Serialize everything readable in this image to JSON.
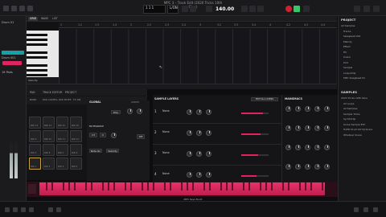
{
  "app_title": "MPC 3 – Track Edit (2020 Tricks 10th Slice)",
  "transport": {
    "bar_display": "1 1 1",
    "tempo": "140.00",
    "mode": "L/ON"
  },
  "left": {
    "track_label": "Drum 01",
    "program_label": "Drum 001",
    "pads_label": "16 Pads"
  },
  "seq_tabs": [
    "GRID",
    "WAVE",
    "LIST"
  ],
  "ruler": [
    "1",
    "1.2",
    "1.3",
    "1.4",
    "2",
    "2.2",
    "2.3",
    "2.4",
    "3",
    "3.2",
    "3.3",
    "3.4",
    "4",
    "4.2",
    "4.3",
    "4.4"
  ],
  "piano_label": "Velocity",
  "panel_tabs": [
    "PAD",
    "TRACK EDITOR",
    "PROJECT"
  ],
  "banks": [
    "BANK",
    "PAD CONFIG",
    "PAD MUTE",
    "FX ON",
    "STEP"
  ],
  "pads": [
    "PAD 13",
    "PAD 14",
    "PAD 15",
    "PAD 16",
    "PAD 9",
    "PAD 10",
    "PAD 11",
    "PAD 12",
    "PAD 5",
    "PAD 6",
    "PAD 7",
    "PAD 8",
    "PAD 1",
    "PAD 2",
    "PAD 3",
    "PAD 4"
  ],
  "global": {
    "header": "GLOBAL",
    "link": "LINKED",
    "poly_label": "Poly",
    "mute_group": "MUTEGROUP",
    "semi": "C3",
    "fine": "0",
    "sense": "Off",
    "sample_play": "Note On",
    "velocity": "Velocity"
  },
  "layers": {
    "header": "SAMPLE LAYERS",
    "edit_button": "EDIT ALL LAYERS",
    "rows": [
      {
        "num": "1",
        "name": "None",
        "vel": 100
      },
      {
        "num": "2",
        "name": "None",
        "vel": 90
      },
      {
        "num": "3",
        "name": "None",
        "vel": 80
      },
      {
        "num": "4",
        "name": "None",
        "vel": 70
      }
    ]
  },
  "macros": {
    "header": "MANGMACS"
  },
  "project": {
    "header": "PROJECT",
    "items": [
      "All Samples",
      "Tracks",
      "Swagbeat 001",
      "Melody",
      "Effect",
      "Fill",
      "Crash",
      "Kick",
      "Sample",
      "Loops/Clip",
      "MPC Swagbeat 01"
    ]
  },
  "samples": {
    "header": "SAMPLES",
    "items": [
      "2023 Tricks 10th Slice",
      "All Loops",
      "All Samples",
      "Sample Tricks",
      "Synth/Clip",
      "Some Sample ETC",
      "HxPD Drum Kit DJ Snare",
      "Whatsup Snare"
    ]
  },
  "keyboard_label": "MPC Keys Build",
  "strip_select": "Drum 01 In",
  "colors": {
    "accent": "#e0245e",
    "teal": "#18a0a8",
    "play": "#38c66b"
  }
}
